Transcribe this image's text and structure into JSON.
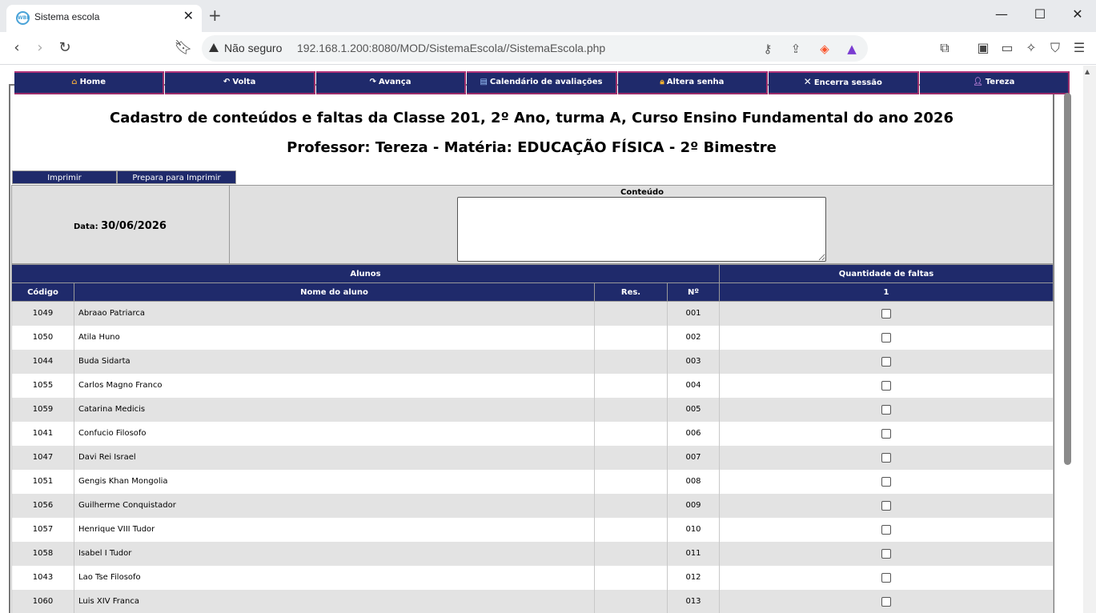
{
  "browser": {
    "tab_title": "Sistema escola",
    "favicon_text": "WBF",
    "security_label": "Não seguro",
    "url": "192.168.1.200:8080/MOD/SistemaEscola//SistemaEscola.php"
  },
  "menu": [
    {
      "label": "Home",
      "icon": "home-icon"
    },
    {
      "label": "Volta",
      "icon": "back-arrow-icon"
    },
    {
      "label": "Avança",
      "icon": "forward-arrow-icon"
    },
    {
      "label": "Calendário de avaliações",
      "icon": "calendar-icon"
    },
    {
      "label": "Altera senha",
      "icon": "lock-icon"
    },
    {
      "label": "Encerra sessão",
      "icon": "close-x-icon"
    },
    {
      "label": "Tereza",
      "icon": "user-icon"
    }
  ],
  "header": {
    "title": "Cadastro de conteúdos e faltas da Classe 201, 2º Ano, turma A, Curso Ensino Fundamental do ano 2026",
    "subtitle": "Professor: Tereza - Matéria: EDUCAÇÃO FÍSICA - 2º Bimestre"
  },
  "actions": {
    "print": "Imprimir",
    "prepare_print": "Prepara para Imprimir"
  },
  "form": {
    "date_label": "Data:",
    "date_value": "30/06/2026",
    "content_label": "Conteúdo",
    "content_value": ""
  },
  "table": {
    "group_students": "Alunos",
    "group_absences": "Quantidade de faltas",
    "col_code": "Código",
    "col_name": "Nome do aluno",
    "col_res": "Res.",
    "col_num": "Nº",
    "col_absence": "1",
    "rows": [
      {
        "code": "1049",
        "name": "Abraao Patriarca",
        "res": "",
        "num": "001",
        "checked": false
      },
      {
        "code": "1050",
        "name": "Atila Huno",
        "res": "",
        "num": "002",
        "checked": false
      },
      {
        "code": "1044",
        "name": "Buda Sidarta",
        "res": "",
        "num": "003",
        "checked": false
      },
      {
        "code": "1055",
        "name": "Carlos Magno Franco",
        "res": "",
        "num": "004",
        "checked": false
      },
      {
        "code": "1059",
        "name": "Catarina Medicis",
        "res": "",
        "num": "005",
        "checked": false
      },
      {
        "code": "1041",
        "name": "Confucio Filosofo",
        "res": "",
        "num": "006",
        "checked": false
      },
      {
        "code": "1047",
        "name": "Davi Rei Israel",
        "res": "",
        "num": "007",
        "checked": false
      },
      {
        "code": "1051",
        "name": "Gengis Khan Mongolia",
        "res": "",
        "num": "008",
        "checked": false
      },
      {
        "code": "1056",
        "name": "Guilherme Conquistador",
        "res": "",
        "num": "009",
        "checked": false
      },
      {
        "code": "1057",
        "name": "Henrique VIII Tudor",
        "res": "",
        "num": "010",
        "checked": false
      },
      {
        "code": "1058",
        "name": "Isabel I Tudor",
        "res": "",
        "num": "011",
        "checked": false
      },
      {
        "code": "1043",
        "name": "Lao Tse Filosofo",
        "res": "",
        "num": "012",
        "checked": false
      },
      {
        "code": "1060",
        "name": "Luis XIV Franca",
        "res": "",
        "num": "013",
        "checked": false
      }
    ]
  }
}
